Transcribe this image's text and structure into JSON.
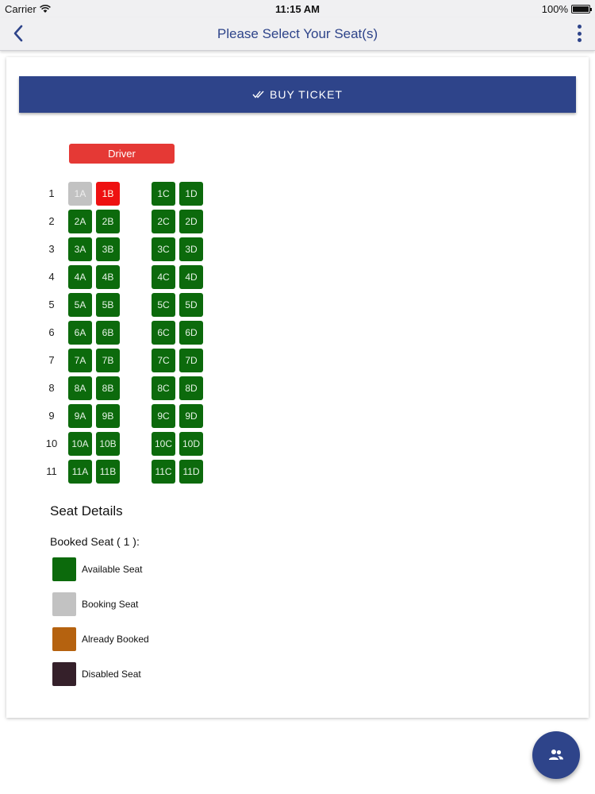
{
  "status": {
    "carrier": "Carrier",
    "time": "11:15 AM",
    "battery": "100%"
  },
  "nav": {
    "title": "Please Select Your Seat(s)",
    "back_icon": "chevron-left-icon",
    "menu_icon": "more-vertical-icon"
  },
  "buy_button": {
    "label": "BUY TICKET",
    "icon": "double-check-icon"
  },
  "driver_label": "Driver",
  "seat_rows": [
    {
      "num": "1",
      "seats": [
        {
          "id": "1A",
          "state": "booking"
        },
        {
          "id": "1B",
          "state": "selected"
        },
        {
          "id": "1C",
          "state": "available"
        },
        {
          "id": "1D",
          "state": "available"
        }
      ]
    },
    {
      "num": "2",
      "seats": [
        {
          "id": "2A",
          "state": "available"
        },
        {
          "id": "2B",
          "state": "available"
        },
        {
          "id": "2C",
          "state": "available"
        },
        {
          "id": "2D",
          "state": "available"
        }
      ]
    },
    {
      "num": "3",
      "seats": [
        {
          "id": "3A",
          "state": "available"
        },
        {
          "id": "3B",
          "state": "available"
        },
        {
          "id": "3C",
          "state": "available"
        },
        {
          "id": "3D",
          "state": "available"
        }
      ]
    },
    {
      "num": "4",
      "seats": [
        {
          "id": "4A",
          "state": "available"
        },
        {
          "id": "4B",
          "state": "available"
        },
        {
          "id": "4C",
          "state": "available"
        },
        {
          "id": "4D",
          "state": "available"
        }
      ]
    },
    {
      "num": "5",
      "seats": [
        {
          "id": "5A",
          "state": "available"
        },
        {
          "id": "5B",
          "state": "available"
        },
        {
          "id": "5C",
          "state": "available"
        },
        {
          "id": "5D",
          "state": "available"
        }
      ]
    },
    {
      "num": "6",
      "seats": [
        {
          "id": "6A",
          "state": "available"
        },
        {
          "id": "6B",
          "state": "available"
        },
        {
          "id": "6C",
          "state": "available"
        },
        {
          "id": "6D",
          "state": "available"
        }
      ]
    },
    {
      "num": "7",
      "seats": [
        {
          "id": "7A",
          "state": "available"
        },
        {
          "id": "7B",
          "state": "available"
        },
        {
          "id": "7C",
          "state": "available"
        },
        {
          "id": "7D",
          "state": "available"
        }
      ]
    },
    {
      "num": "8",
      "seats": [
        {
          "id": "8A",
          "state": "available"
        },
        {
          "id": "8B",
          "state": "available"
        },
        {
          "id": "8C",
          "state": "available"
        },
        {
          "id": "8D",
          "state": "available"
        }
      ]
    },
    {
      "num": "9",
      "seats": [
        {
          "id": "9A",
          "state": "available"
        },
        {
          "id": "9B",
          "state": "available"
        },
        {
          "id": "9C",
          "state": "available"
        },
        {
          "id": "9D",
          "state": "available"
        }
      ]
    },
    {
      "num": "10",
      "seats": [
        {
          "id": "10A",
          "state": "available"
        },
        {
          "id": "10B",
          "state": "available"
        },
        {
          "id": "10C",
          "state": "available"
        },
        {
          "id": "10D",
          "state": "available"
        }
      ]
    },
    {
      "num": "11",
      "seats": [
        {
          "id": "11A",
          "state": "available"
        },
        {
          "id": "11B",
          "state": "available"
        },
        {
          "id": "11C",
          "state": "available"
        },
        {
          "id": "11D",
          "state": "available"
        }
      ]
    }
  ],
  "details": {
    "title": "Seat Details",
    "booked_line": "Booked Seat ( 1 ):",
    "legend": [
      {
        "label": "Available Seat",
        "color": "#0c6a0c"
      },
      {
        "label": "Booking Seat",
        "color": "#c2c2c2"
      },
      {
        "label": "Already Booked",
        "color": "#b5620f"
      },
      {
        "label": "Disabled Seat",
        "color": "#35202a"
      }
    ]
  },
  "fab_icon": "passengers-icon",
  "colors": {
    "brand": "#2e448a",
    "available": "#0c6a0c",
    "booking": "#c2c2c2",
    "selected": "#ee1111",
    "driver": "#e53935"
  }
}
